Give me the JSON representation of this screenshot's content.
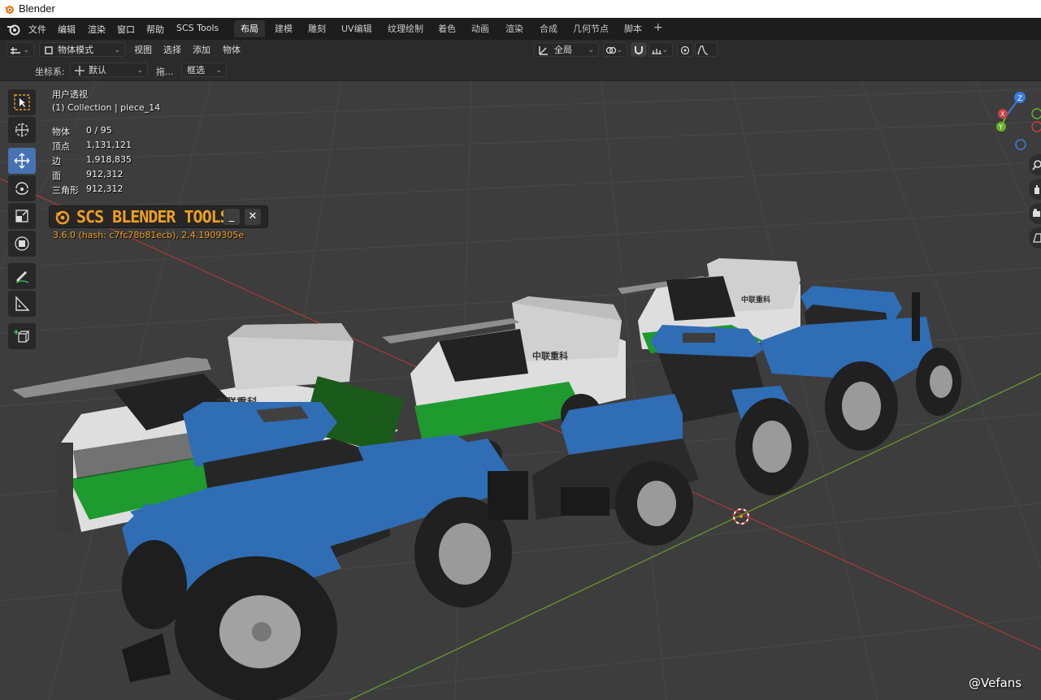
{
  "window": {
    "title": "Blender"
  },
  "menubar": {
    "items": [
      "文件",
      "编辑",
      "渲染",
      "窗口",
      "帮助",
      "SCS Tools"
    ],
    "workspaces": [
      "布局",
      "建模",
      "雕刻",
      "UV编辑",
      "纹理绘制",
      "着色",
      "动画",
      "渲染",
      "合成",
      "几何节点",
      "脚本"
    ],
    "active_workspace": "布局",
    "add_label": "+"
  },
  "header": {
    "mode": "物体模式",
    "menus": [
      "视图",
      "选择",
      "添加",
      "物体"
    ],
    "transform_orientation": "全局"
  },
  "tool_settings": {
    "coord_label": "坐标系:",
    "coord_value": "默认",
    "drag_label": "拖...",
    "select_value": "框选"
  },
  "viewport": {
    "view_name": "用户透视",
    "collection": "(1) Collection | piece_14",
    "stats": [
      {
        "key": "物体",
        "value": "0 / 95"
      },
      {
        "key": "顶点",
        "value": "1,131,121"
      },
      {
        "key": "边",
        "value": "1,918,835"
      },
      {
        "key": "面",
        "value": "912,312"
      },
      {
        "key": "三角形",
        "value": "912,312"
      }
    ]
  },
  "scs_panel": {
    "title": "SCS BLENDER TOOLS",
    "minimize": "_",
    "close": "✕",
    "version": "3.6.0 (hash: c7fc78b81ecb), 2.4.1909305e"
  },
  "gizmo": {
    "z": "Z",
    "y": "Y",
    "x": "X"
  },
  "harvester_label": "中联重科",
  "watermark": "@Vefans",
  "colors": {
    "accent": "#4772b3",
    "scs_orange": "#f0a020",
    "tractor_blue": "#2f6db5",
    "harvester_green": "#1e9a2e"
  }
}
